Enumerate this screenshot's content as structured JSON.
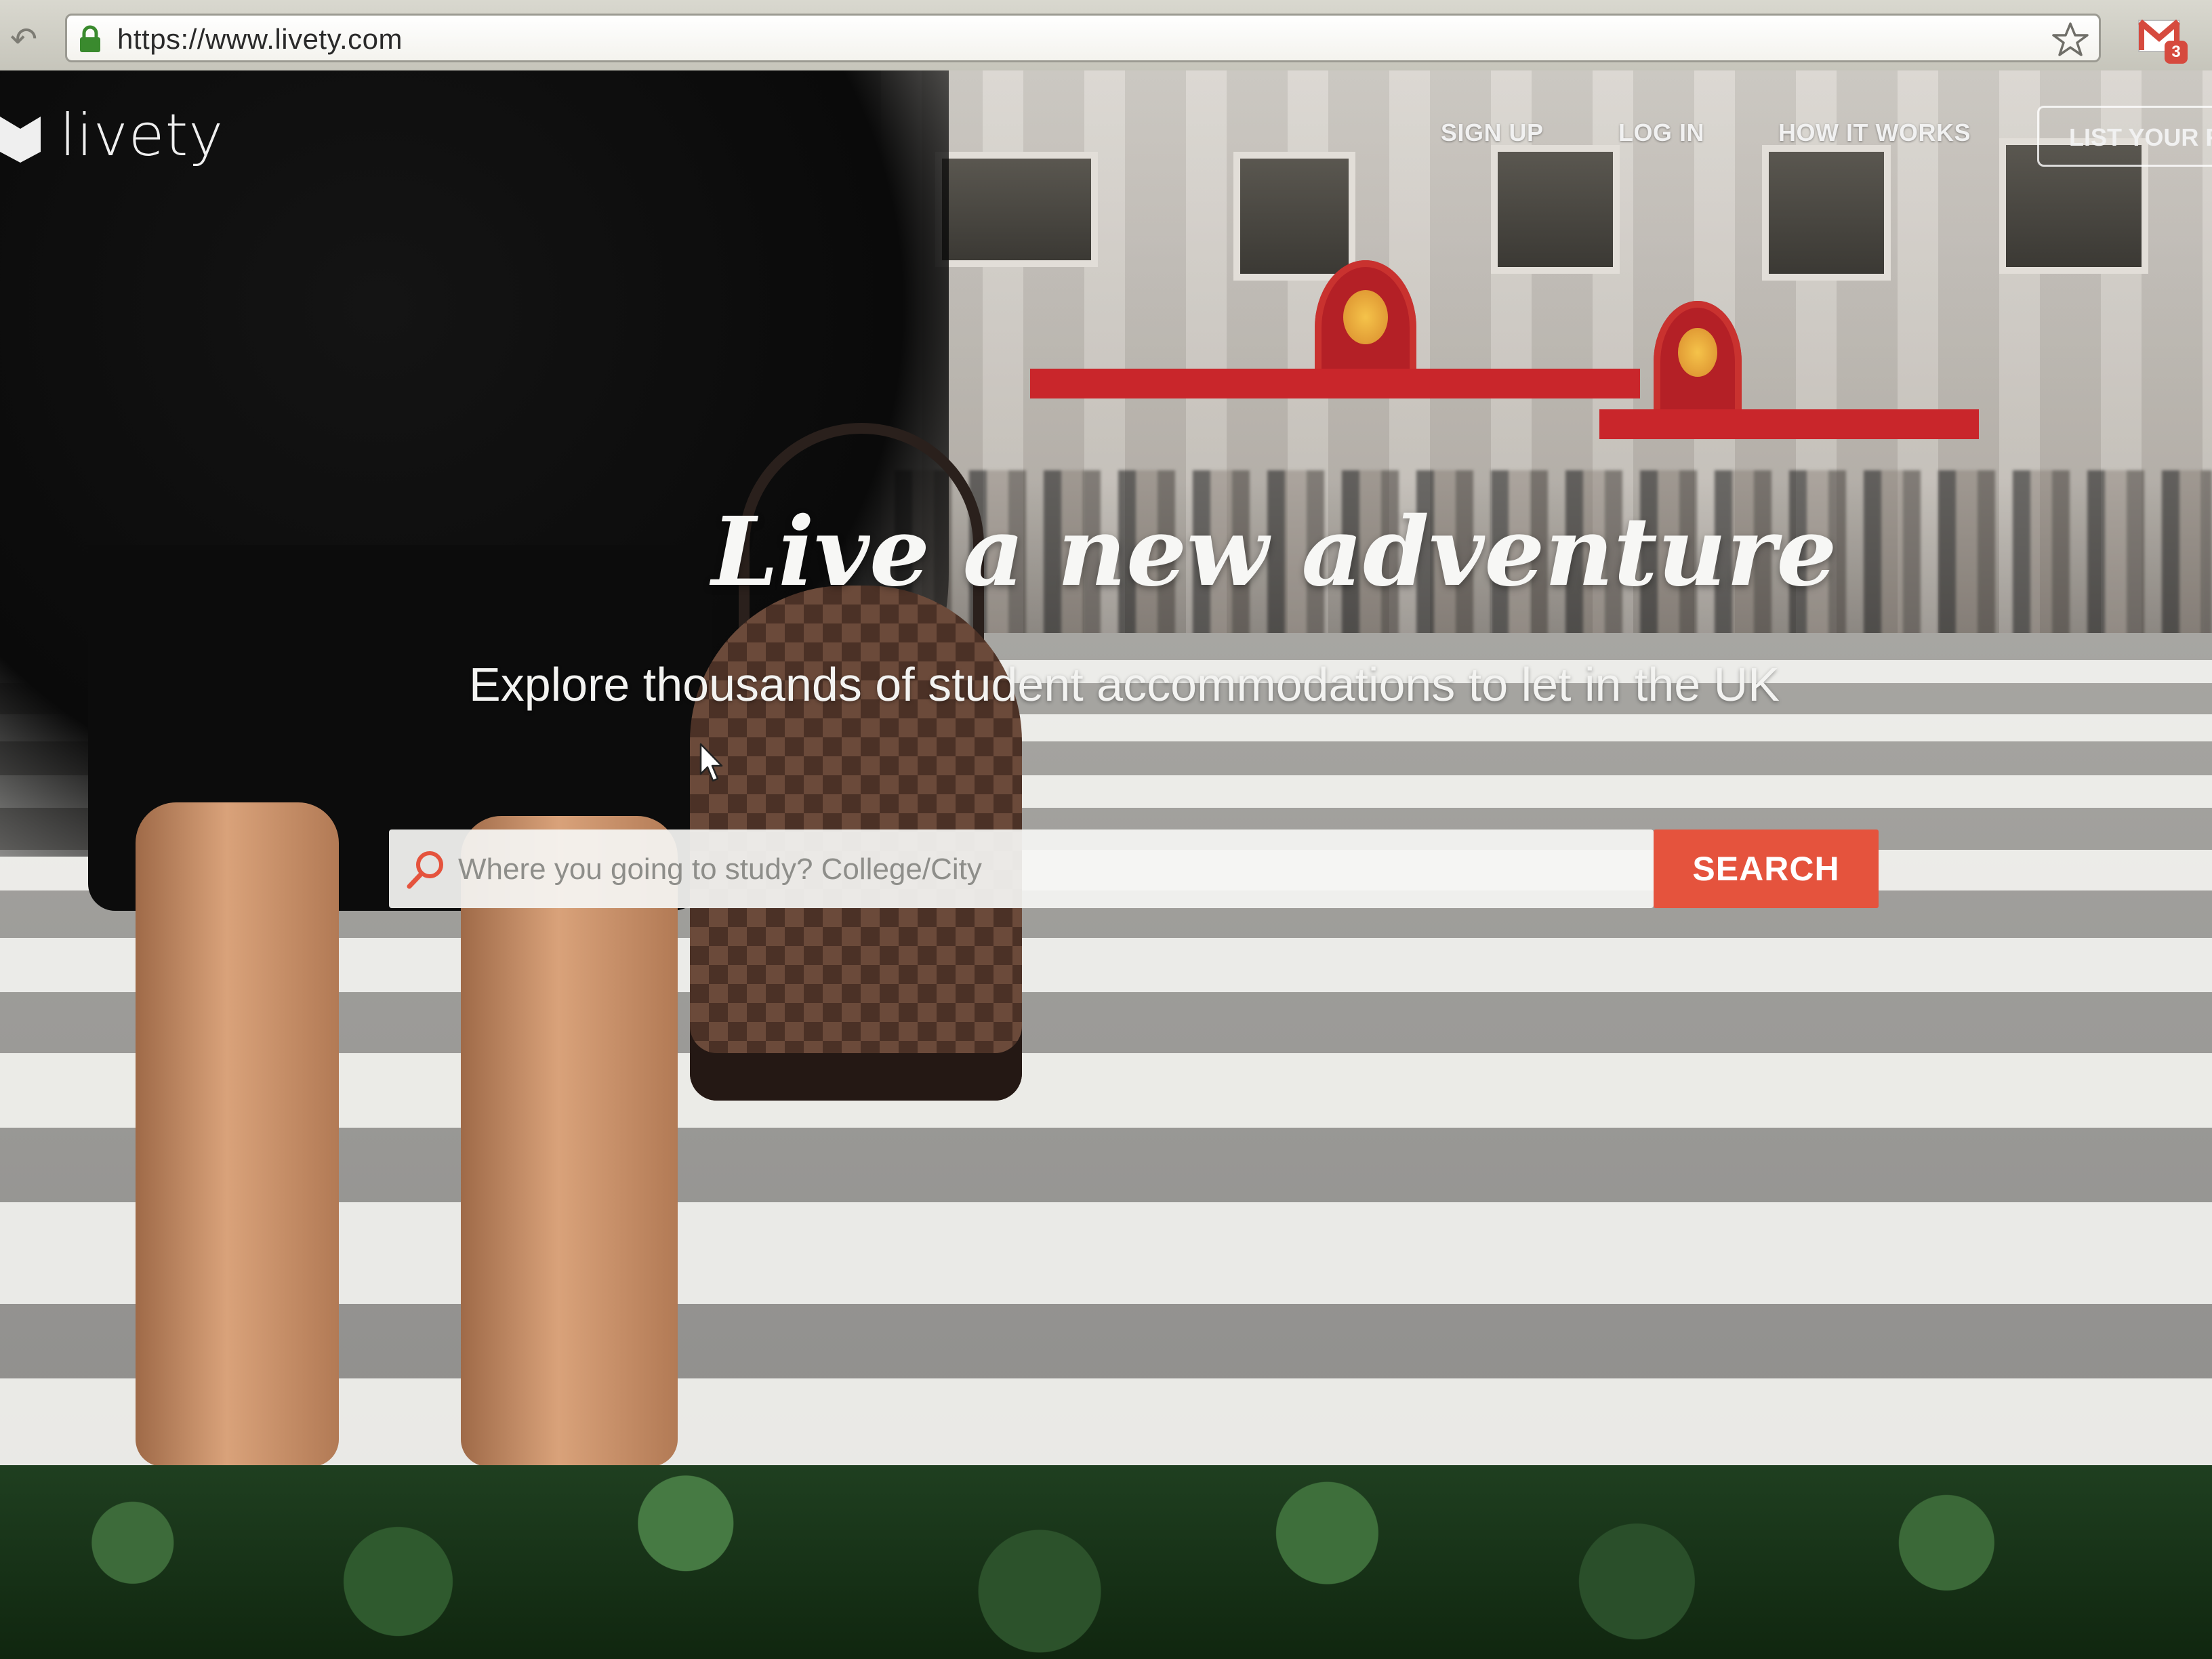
{
  "browser": {
    "url": "https://www.livety.com",
    "gmail_count": "3"
  },
  "site": {
    "logo_text": "livety",
    "nav": {
      "sign_up": "SIGN UP",
      "log_in": "LOG IN",
      "how_it_works": "HOW IT WORKS",
      "list_your_room": "LIST YOUR RO"
    }
  },
  "hero": {
    "headline": "Live a new adventure",
    "subheadline": "Explore thousands of student accommodations to let in the UK"
  },
  "search": {
    "placeholder": "Where you going to study? College/City",
    "value": "",
    "button_label": "SEARCH"
  },
  "colors": {
    "accent": "#e5533d",
    "url_lock": "#3a8a2e"
  }
}
